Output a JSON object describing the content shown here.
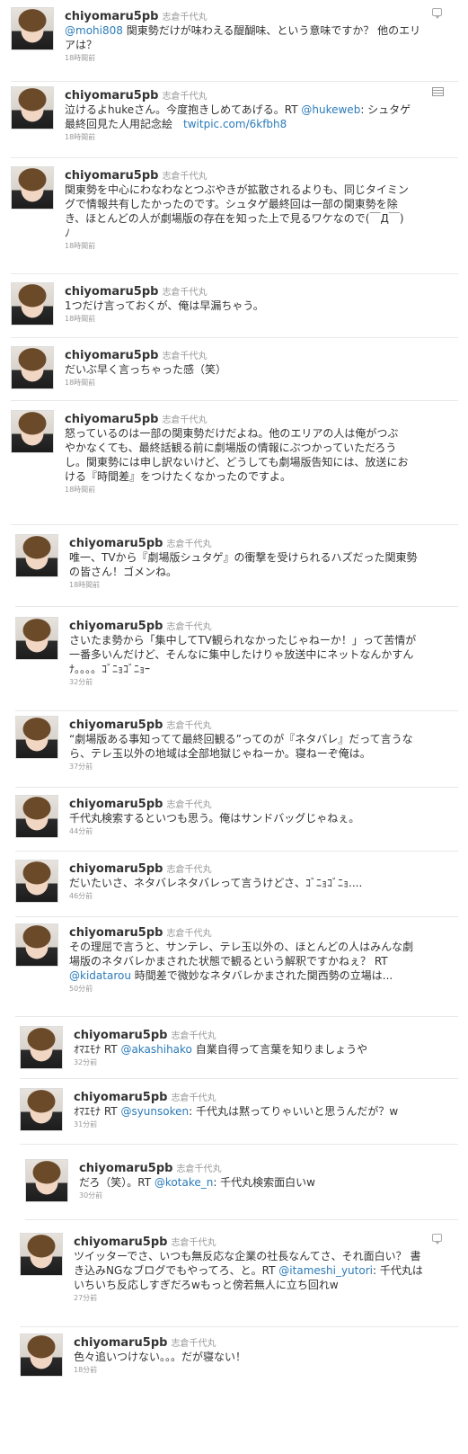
{
  "user": {
    "screen_name": "chiyomaru5pb",
    "full_name": "志倉千代丸"
  },
  "tweets": [
    {
      "segments": [
        {
          "text": "@mohi808",
          "type": "mention"
        },
        {
          "text": " 関東勢だけが味わえる醍醐味、という意味ですか？ 他のエリ",
          "type": "text"
        },
        {
          "br": true
        },
        {
          "text": "アは？",
          "type": "text"
        }
      ],
      "time": "18時間前",
      "icon": "reply-icon"
    },
    {
      "segments": [
        {
          "text": "泣けるよhukeさん。今度抱きしめてあげる。RT ",
          "type": "text"
        },
        {
          "text": "@hukeweb",
          "type": "mention"
        },
        {
          "text": ": シュタゲ",
          "type": "text"
        },
        {
          "br": true
        },
        {
          "text": "最終回見た人用記念絵　",
          "type": "text"
        },
        {
          "text": "twitpic.com/6kfbh8",
          "type": "link"
        }
      ],
      "time": "18時間前",
      "icon": "media-icon"
    },
    {
      "segments": [
        {
          "text": "関東勢を中心にわなわなとつぶやきが拡散されるよりも、同じタイミン",
          "type": "text"
        },
        {
          "br": true
        },
        {
          "text": "グで情報共有したかったのです。シュタゲ最終回は一部の関東勢を除",
          "type": "text"
        },
        {
          "br": true
        },
        {
          "text": "き、ほとんどの人が劇場版の存在を知った上で見るワケなので(￣Д￣)",
          "type": "text"
        },
        {
          "br": true
        },
        {
          "text": "ﾉ",
          "type": "text"
        }
      ],
      "time": "18時間前"
    },
    {
      "segments": [
        {
          "text": "1つだけ言っておくが、俺は早漏ちゃう。",
          "type": "text"
        }
      ],
      "time": "18時間前"
    },
    {
      "segments": [
        {
          "text": "だいぶ早く言っちゃった感（笑）",
          "type": "text"
        }
      ],
      "time": "18時間前"
    },
    {
      "segments": [
        {
          "text": "怒っているのは一部の関東勢だけだよね。他のエリアの人は俺がつぶ",
          "type": "text"
        },
        {
          "br": true
        },
        {
          "text": "やかなくても、最終話観る前に劇場版の情報にぶつかっていただろう",
          "type": "text"
        },
        {
          "br": true
        },
        {
          "text": "し。関東勢には申し訳ないけど、どうしても劇場版告知には、放送にお",
          "type": "text"
        },
        {
          "br": true
        },
        {
          "text": "ける『時間差』をつけたくなかったのですよ。",
          "type": "text"
        }
      ],
      "time": "18時間前"
    },
    {
      "segments": [
        {
          "text": "唯一、TVから『劇場版シュタゲ』の衝撃を受けられるハズだった関東勢",
          "type": "text"
        },
        {
          "br": true
        },
        {
          "text": "の皆さん！ゴメンね。",
          "type": "text"
        }
      ],
      "time": "18時間前"
    },
    {
      "segments": [
        {
          "text": "さいたま勢から「集中してTV観られなかったじゃねーか！」って苦情が",
          "type": "text"
        },
        {
          "br": true
        },
        {
          "text": "一番多いんだけど、そんなに集中したけりゃ放送中にネットなんかすん",
          "type": "text"
        },
        {
          "br": true
        },
        {
          "text": "ﾅ。。。。ｺﾞﾆｮｺﾞﾆｮｰ",
          "type": "text"
        }
      ],
      "time": "32分前"
    },
    {
      "segments": [
        {
          "text": "“劇場版ある事知ってて最終回観る”ってのが『ネタバレ』だって言うな",
          "type": "text"
        },
        {
          "br": true
        },
        {
          "text": "ら、テレ玉以外の地域は全部地獄じゃねーか。寝ねーぞ俺は。",
          "type": "text"
        }
      ],
      "time": "37分前"
    },
    {
      "segments": [
        {
          "text": "千代丸検索するといつも思う。俺はサンドバッグじゃねぇ。",
          "type": "text"
        }
      ],
      "time": "44分前"
    },
    {
      "segments": [
        {
          "text": "だいたいさ、ネタバレネタバレって言うけどさ、ｺﾞﾆｮｺﾞﾆｮ....",
          "type": "text"
        }
      ],
      "time": "46分前"
    },
    {
      "segments": [
        {
          "text": "その理屈で言うと、サンテレ、テレ玉以外の、ほとんどの人はみんな劇",
          "type": "text"
        },
        {
          "br": true
        },
        {
          "text": "場版のネタバレかまされた状態で観るという解釈ですかねぇ？ RT",
          "type": "text"
        },
        {
          "br": true
        },
        {
          "text": "@kidatarou",
          "type": "mention"
        },
        {
          "text": " 時間差で微妙なネタバレかまされた関西勢の立場は...",
          "type": "text"
        }
      ],
      "time": "50分前"
    },
    {
      "segments": [
        {
          "text": "ｵﾏｴﾓﾅ RT ",
          "type": "text"
        },
        {
          "text": "@akashihako",
          "type": "mention"
        },
        {
          "text": " 自業自得って言葉を知りましょうや",
          "type": "text"
        }
      ],
      "time": "32分前"
    },
    {
      "segments": [
        {
          "text": "ｵﾏｴﾓﾅ RT ",
          "type": "text"
        },
        {
          "text": "@syunsoken",
          "type": "mention"
        },
        {
          "text": ": 千代丸は黙ってりゃいいと思うんだが？w",
          "type": "text"
        }
      ],
      "time": "31分前"
    },
    {
      "segments": [
        {
          "text": "だろ（笑）。RT ",
          "type": "text"
        },
        {
          "text": "@kotake_n",
          "type": "mention"
        },
        {
          "text": ": 千代丸検索面白いw",
          "type": "text"
        }
      ],
      "time": "30分前"
    },
    {
      "segments": [
        {
          "text": "ツイッターでさ、いつも無反応な企業の社長なんてさ、それ面白い？ 書",
          "type": "text"
        },
        {
          "br": true
        },
        {
          "text": "き込みNGなブログでもやってろ、と。RT ",
          "type": "text"
        },
        {
          "text": "@itameshi_yutori",
          "type": "mention"
        },
        {
          "text": ": 千代丸は",
          "type": "text"
        },
        {
          "br": true
        },
        {
          "text": "いちいち反応しすぎだろwもっと傍若無人に立ち回れw",
          "type": "text"
        }
      ],
      "time": "27分前",
      "icon": "reply-icon"
    },
    {
      "segments": [
        {
          "text": "色々追いつけない。。。だが寝ない！",
          "type": "text"
        }
      ],
      "time": "18分前"
    }
  ]
}
